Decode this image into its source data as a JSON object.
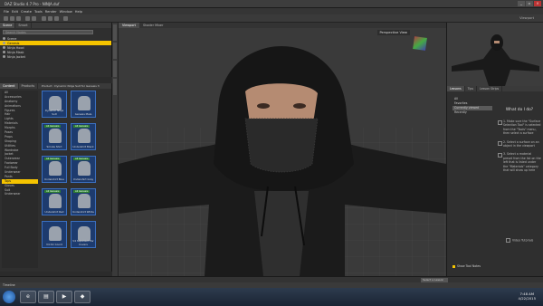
{
  "window": {
    "title": "DAZ Studio 4.7 Pro - NINJA.duf"
  },
  "menu": [
    "File",
    "Edit",
    "Create",
    "Tools",
    "Render",
    "Window",
    "Help"
  ],
  "toolbar": {
    "right_label": "Viewport"
  },
  "scene": {
    "tabs": [
      "Scene",
      "Smart"
    ],
    "search_placeholder": "Search Nodes",
    "nodes": [
      {
        "label": "Scene",
        "selected": false
      },
      {
        "label": "Genesis",
        "selected": true
      },
      {
        "label": "Ninja Hood",
        "selected": false
      },
      {
        "label": "Ninja Mask",
        "selected": false
      },
      {
        "label": "Ninja Jacket",
        "selected": false
      }
    ]
  },
  "library": {
    "tabs": [
      "Content",
      "Products"
    ],
    "header": "Product : Dynamic Ninja Suit for Genesis 3",
    "categories": [
      "All",
      "Accessories",
      "Anatomy",
      "Animations",
      "Figures",
      "Hair",
      "Lights",
      "Materials",
      "Morphs",
      "Poses",
      "Props",
      "Shaping",
      "Utilities",
      "Wardrobe",
      "Jacket",
      "Outerwear",
      "Footwear",
      "Full Body",
      "Underwear",
      "Pants",
      "Tops",
      "Gloves",
      "Suit",
      "Underwear"
    ],
    "selected_category": "Tops",
    "items": [
      {
        "label": "Dynamic Ninja Suit",
        "badge": ""
      },
      {
        "label": "Genesis Male",
        "badge": ""
      },
      {
        "label": "Smoke Shirt",
        "badge": "All Genesis"
      },
      {
        "label": "Undershirt Black",
        "badge": "All Genesis"
      },
      {
        "label": "Undershirt Blue",
        "badge": "All Genesis"
      },
      {
        "label": "Undershirt Gray",
        "badge": "All Genesis"
      },
      {
        "label": "Undershirt Red",
        "badge": "All Genesis"
      },
      {
        "label": "Undershirt White",
        "badge": "All Genesis"
      },
      {
        "label": "V4 Dir Coord",
        "badge": ""
      },
      {
        "label": "V4 Supersuit Ear Covers",
        "badge": ""
      }
    ]
  },
  "viewport": {
    "tabs": [
      "Viewport",
      "Shader Mixer"
    ],
    "camera_label": "Perspective View"
  },
  "right_panel": {
    "tabs": [
      "Lessons",
      "Tips",
      "Lesson Strips"
    ],
    "list": [
      "All",
      "Favorites",
      "Currently viewed",
      "Recently"
    ],
    "selected_item": "Currently viewed",
    "help_title": "What do I do?",
    "steps": [
      "1. Make sure the \"Surface Selection Tool\" is selected from the \"Tools\" menu, then select a surface",
      "2. Select a surface on an object in the viewport",
      "3. Select a material preset from the list on the left that is listed under the \"Materials\" category that will show up here"
    ],
    "video_label": "Video Tutorials",
    "show_checkbox": "Show Tool Notes"
  },
  "status": {
    "lesson_select": "Select a Lesson"
  },
  "bottom_tab": "Timeline",
  "taskbar": {
    "apps": [
      "IE",
      "Explorer",
      "Media",
      "DAZ"
    ],
    "time": "7:48 AM",
    "date": "4/22/2015"
  },
  "colors": {
    "selection": "#f5c400",
    "panel": "#2f2f2f",
    "viewport": "#3b3b3b"
  }
}
